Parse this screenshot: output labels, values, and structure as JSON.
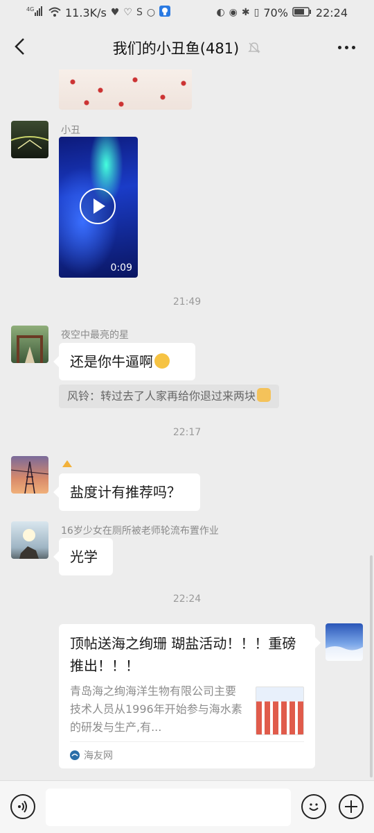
{
  "status_bar": {
    "network": "4G",
    "speed": "11.3K/s",
    "battery": "70%",
    "time": "22:24"
  },
  "header": {
    "title": "我们的小丑鱼(481)"
  },
  "messages": [
    {
      "sender": "小丑",
      "video_duration": "0:09"
    },
    {
      "timestamp": "21:49"
    },
    {
      "sender": "夜空中最亮的星",
      "text": "还是你牛逼啊",
      "quote": "风铃：转过去了人家再给你退过来两块"
    },
    {
      "timestamp": "22:17"
    },
    {
      "text": "盐度计有推荐吗？"
    },
    {
      "sender": "16岁少女在厕所被老师轮流布置作业",
      "text": "光学"
    },
    {
      "timestamp": "22:24"
    }
  ],
  "card": {
    "title": "顶帖送海之绚珊 瑚盐活动！！！重磅推出！！！",
    "description": "青岛海之绚海洋生物有限公司主要技术人员从1996年开始参与海水素的研发与生产,有...",
    "source": "海友网"
  },
  "input": {
    "placeholder": ""
  }
}
